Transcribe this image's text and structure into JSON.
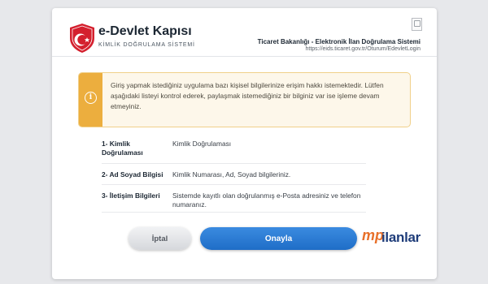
{
  "header": {
    "logo_title": "e-Devlet Kapısı",
    "logo_subtitle": "KİMLİK DOĞRULAMA SİSTEMİ",
    "ministry": "Ticaret Bakanlığı - Elektronik İlan Doğrulama Sistemi",
    "ministry_url": "https://eids.ticaret.gov.tr/Oturum/EdevletLogin"
  },
  "alert": {
    "icon": "info-icon",
    "text": "Giriş yapmak istediğiniz uygulama bazı kişisel bilgilerinize erişim hakkı istemektedir. Lütfen aşağıdaki listeyi kontrol ederek, paylaşmak istemediğiniz bir bilginiz var ise işleme devam etmeyiniz."
  },
  "permissions": [
    {
      "label": "1- Kimlik Doğrulaması",
      "desc": "Kimlik Doğrulaması"
    },
    {
      "label": "2- Ad Soyad Bilgisi",
      "desc": "Kimlik Numarası, Ad, Soyad bilgileriniz."
    },
    {
      "label": "3- İletişim Bilgileri",
      "desc": "Sistemde kayıtlı olan doğrulanmış e-Posta adresiniz ve telefon numaranız."
    }
  ],
  "actions": {
    "cancel_label": "İptal",
    "approve_label": "Onayla"
  },
  "brand": {
    "mp": "mp",
    "name": "ilanlar"
  },
  "colors": {
    "accent_blue": "#2a7bd6",
    "alert_orange": "#ecae3e",
    "emblem_red": "#d4202e"
  }
}
